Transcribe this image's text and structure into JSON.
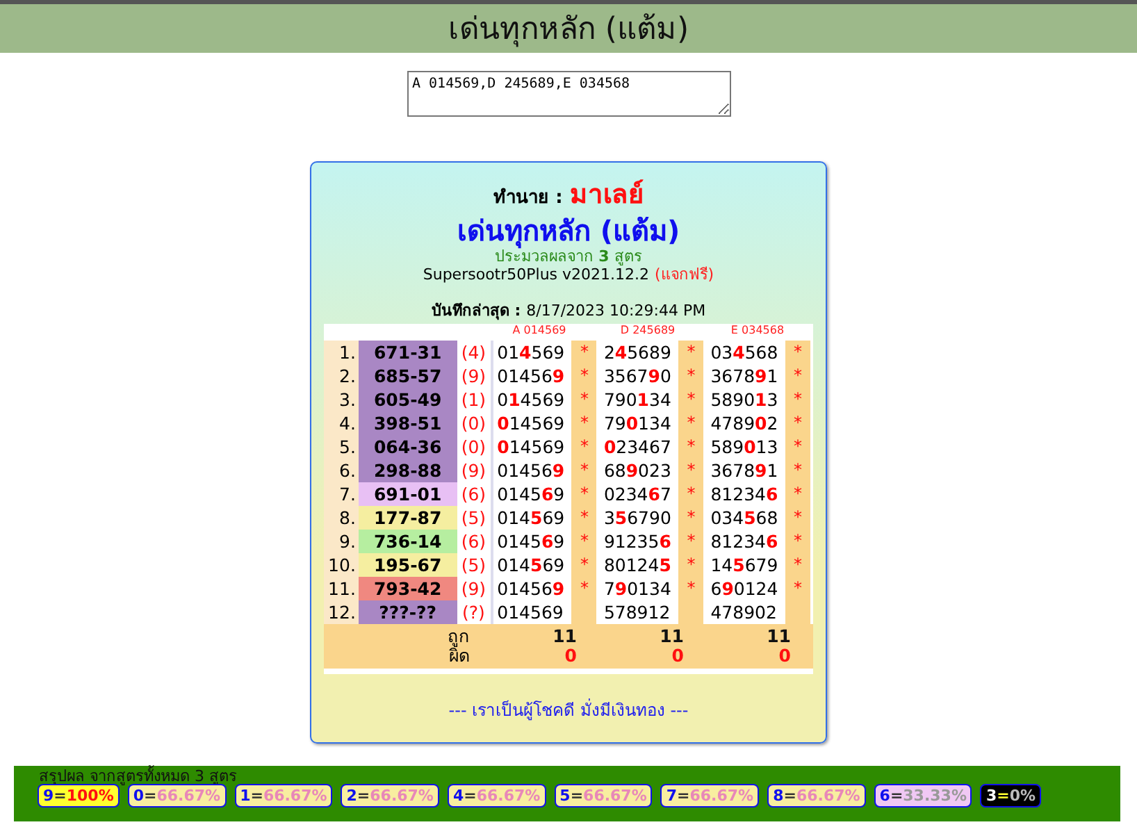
{
  "header": {
    "title": "เด่นทุกหลัก (แต้ม)"
  },
  "input": {
    "value": "A 014569,D 245689,E 034568"
  },
  "card": {
    "predict_label": "ทำนาย :",
    "predict_value": "มาเลย์",
    "title": "เด่นทุกหลัก (แต้ม)",
    "subtitle": "ประมวลผลจาก **3** สูตร",
    "version": "Supersootr50Plus v2021.12.2",
    "version_note": "(แจกฟรี)",
    "saved_label": "บันทึกล่าสุด :",
    "saved_value": "8/17/2023 10:29:44 PM",
    "footer": "--- เราเป็นผู้โชคดี มั่งมีเงินทอง ---"
  },
  "table": {
    "columns": [
      "A 014569",
      "D 245689",
      "E 034568"
    ],
    "rows": [
      {
        "index": "1.",
        "number": "671-31",
        "color": "#a987c4",
        "digit": "(4)",
        "cells": [
          {
            "value": "01**4**569",
            "mark": "*"
          },
          {
            "value": "2**4**5689",
            "mark": "*"
          },
          {
            "value": "03**4**568",
            "mark": "*"
          }
        ]
      },
      {
        "index": "2.",
        "number": "685-57",
        "color": "#a987c4",
        "digit": "(9)",
        "cells": [
          {
            "value": "01456**9**",
            "mark": "*"
          },
          {
            "value": "3567**9**0",
            "mark": "*"
          },
          {
            "value": "3678**9**1",
            "mark": "*"
          }
        ]
      },
      {
        "index": "3.",
        "number": "605-49",
        "color": "#a987c4",
        "digit": "(1)",
        "cells": [
          {
            "value": "0**1**4569",
            "mark": "*"
          },
          {
            "value": "790**1**34",
            "mark": "*"
          },
          {
            "value": "5890**1**3",
            "mark": "*"
          }
        ]
      },
      {
        "index": "4.",
        "number": "398-51",
        "color": "#a987c4",
        "digit": "(0)",
        "cells": [
          {
            "value": "**0**14569",
            "mark": "*"
          },
          {
            "value": "79**0**134",
            "mark": "*"
          },
          {
            "value": "4789**0**2",
            "mark": "*"
          }
        ]
      },
      {
        "index": "5.",
        "number": "064-36",
        "color": "#a987c4",
        "digit": "(0)",
        "cells": [
          {
            "value": "**0**14569",
            "mark": "*"
          },
          {
            "value": "**0**23467",
            "mark": "*"
          },
          {
            "value": "589**0**13",
            "mark": "*"
          }
        ]
      },
      {
        "index": "6.",
        "number": "298-88",
        "color": "#a987c4",
        "digit": "(9)",
        "cells": [
          {
            "value": "01456**9**",
            "mark": "*"
          },
          {
            "value": "68**9**023",
            "mark": "*"
          },
          {
            "value": "3678**9**1",
            "mark": "*"
          }
        ]
      },
      {
        "index": "7.",
        "number": "691-01",
        "color": "#e8c0f4",
        "digit": "(6)",
        "cells": [
          {
            "value": "0145**6**9",
            "mark": "*"
          },
          {
            "value": "0234**6**7",
            "mark": "*"
          },
          {
            "value": "81234**6**",
            "mark": "*"
          }
        ]
      },
      {
        "index": "8.",
        "number": "177-87",
        "color": "#f5eea0",
        "digit": "(5)",
        "cells": [
          {
            "value": "014**5**69",
            "mark": "*"
          },
          {
            "value": "3**5**6790",
            "mark": "*"
          },
          {
            "value": "034**5**68",
            "mark": "*"
          }
        ]
      },
      {
        "index": "9.",
        "number": "736-14",
        "color": "#b6eea0",
        "digit": "(6)",
        "cells": [
          {
            "value": "0145**6**9",
            "mark": "*"
          },
          {
            "value": "91235**6**",
            "mark": "*"
          },
          {
            "value": "81234**6**",
            "mark": "*"
          }
        ]
      },
      {
        "index": "10.",
        "number": "195-67",
        "color": "#f5eea0",
        "digit": "(5)",
        "cells": [
          {
            "value": "014**5**69",
            "mark": "*"
          },
          {
            "value": "80124**5**",
            "mark": "*"
          },
          {
            "value": "14**5**679",
            "mark": "*"
          }
        ]
      },
      {
        "index": "11.",
        "number": "793-42",
        "color": "#f08880",
        "digit": "(9)",
        "cells": [
          {
            "value": "01456**9**",
            "mark": "*"
          },
          {
            "value": "7**9**0134",
            "mark": "*"
          },
          {
            "value": "6**9**0124",
            "mark": "*"
          }
        ]
      },
      {
        "index": "12.",
        "number": "???-??",
        "color": "#a987c4",
        "digit": "(?)",
        "cells": [
          {
            "value": "014569"
          },
          {
            "value": "578912"
          },
          {
            "value": "478902"
          }
        ]
      }
    ],
    "totals": [
      {
        "label": "ถูก",
        "values": [
          "11",
          "11",
          "11"
        ],
        "kind": "hit"
      },
      {
        "label": "ผิด",
        "values": [
          "0",
          "0",
          "0"
        ],
        "kind": "miss"
      }
    ]
  },
  "summary": {
    "title": "สรุปผล จากสูตรทั้งหมด 3 สูตร",
    "badges": [
      {
        "digit": "9",
        "sep": "=",
        "pct": "100%",
        "kind": "full"
      },
      {
        "digit": "0",
        "sep": "=",
        "pct": "66.67%",
        "kind": "partial"
      },
      {
        "digit": "1",
        "sep": "=",
        "pct": "66.67%",
        "kind": "partial"
      },
      {
        "digit": "2",
        "sep": "=",
        "pct": "66.67%",
        "kind": "partial"
      },
      {
        "digit": "4",
        "sep": "=",
        "pct": "66.67%",
        "kind": "partial"
      },
      {
        "digit": "5",
        "sep": "=",
        "pct": "66.67%",
        "kind": "partial"
      },
      {
        "digit": "7",
        "sep": "=",
        "pct": "66.67%",
        "kind": "partial"
      },
      {
        "digit": "8",
        "sep": "=",
        "pct": "66.67%",
        "kind": "partial"
      },
      {
        "digit": "6",
        "sep": "=",
        "pct": "33.33%",
        "kind": "low"
      },
      {
        "digit": "3",
        "sep": "=",
        "pct": "0%",
        "kind": "zero"
      }
    ]
  }
}
